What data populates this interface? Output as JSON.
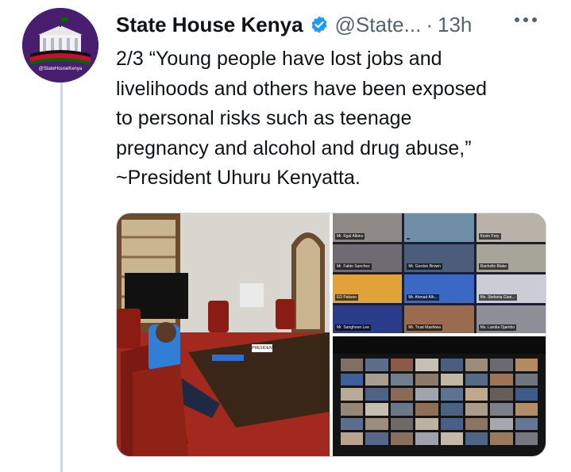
{
  "account": {
    "display_name": "State House Kenya",
    "handle": "@State...",
    "separator": "·",
    "time": "13h",
    "avatar_caption": "@StateHouseKenya"
  },
  "tweet": {
    "lines": [
      "2/3 “Young people have lost jobs and",
      "livelihoods and others have been exposed",
      "to personal risks such as teenage",
      "pregnancy and alcohol and drug abuse,”",
      "~President Uhuru Kenyatta."
    ]
  },
  "media": {
    "photo1": {
      "nameplate": "PRESIDENT"
    },
    "photo2": {
      "participants": [
        "Mr. Kgal Albino",
        "",
        "Kevin Frey",
        "Mr. Fabio Sanchez",
        "Mr. Gordon Brown",
        "Rachelle Blake",
        "ED Pakson",
        "Mr. Ahmad Alh...",
        "Ms. Stefania Gian...",
        "Mr. Sanghoon Lee",
        "Mr. Trust Mashiwa",
        "Ms. Landia Ojambo"
      ]
    }
  },
  "colors": {
    "name": "#0f1419",
    "secondary": "#536471",
    "verified": "#1d9bf0",
    "thread_line": "#cfd9de",
    "avatar_bg": "#4a1e6e"
  },
  "icons": {
    "verified": "verified-badge-icon",
    "more": "more-dots-icon"
  }
}
